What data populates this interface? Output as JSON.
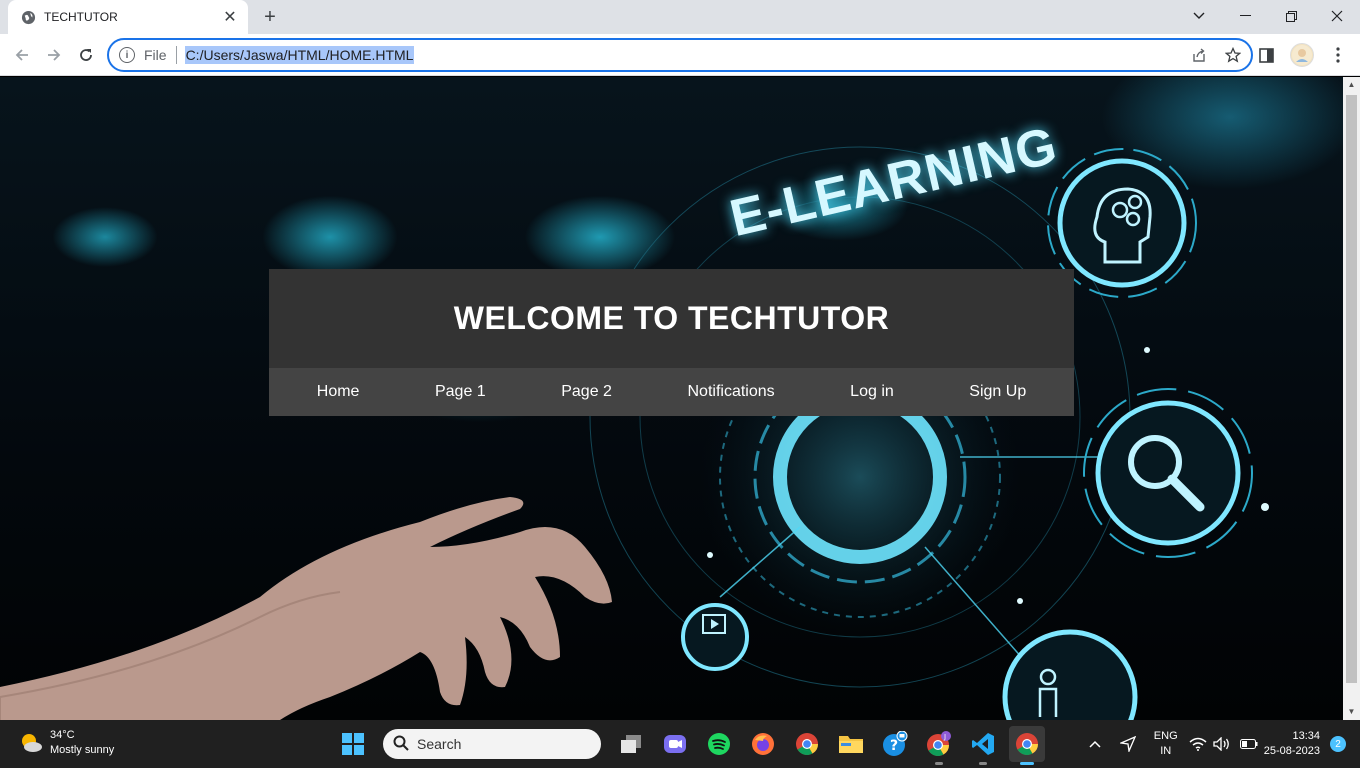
{
  "browser": {
    "tab_title": "TECHTUTOR",
    "omnibox_scheme_label": "File",
    "url": "C:/Users/Jaswa/HTML/HOME.HTML"
  },
  "page": {
    "hero_text": "E-LEARNING",
    "site_title": "WELCOME TO TECHTUTOR",
    "nav": [
      "Home",
      "Page 1",
      "Page 2",
      "Notifications",
      "Log in",
      "Sign Up"
    ]
  },
  "taskbar": {
    "weather_temp": "34°C",
    "weather_desc": "Mostly sunny",
    "search_placeholder": "Search",
    "lang_line1": "ENG",
    "lang_line2": "IN",
    "time": "13:34",
    "date": "25-08-2023",
    "notification_count": "2"
  },
  "colors": {
    "header_bg": "#333333",
    "nav_bg": "#444444",
    "accent_glow": "#28c8e6",
    "omnibox_focus": "#1a73e8"
  }
}
